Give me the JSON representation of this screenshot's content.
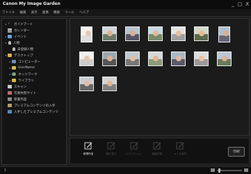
{
  "window": {
    "title": "Canon My Image Garden",
    "min": "_",
    "max": "□",
    "close": "X"
  },
  "menu": [
    "ファイル",
    "編集",
    "表示",
    "画像",
    "機能",
    "ツール",
    "ヘルプ"
  ],
  "sidebar": [
    {
      "label": "ガイドアート",
      "icon": "check-icon",
      "arrow": "▸"
    },
    {
      "label": "カレンダー",
      "icon": "calendar-icon",
      "arrow": ""
    },
    {
      "label": "イベント",
      "icon": "event-icon",
      "arrow": "▸"
    },
    {
      "label": "人物",
      "icon": "person-icon",
      "arrow": "▾"
    },
    {
      "label": "未登録人物",
      "icon": "person-icon",
      "arrow": "",
      "indent": 1
    },
    {
      "label": "デスクトップ",
      "icon": "folder-icon",
      "arrow": "▾"
    },
    {
      "label": "コンピューター",
      "icon": "pc-icon",
      "arrow": "▸",
      "indent": 1
    },
    {
      "label": "UserName",
      "icon": "folder-icon",
      "arrow": "▸",
      "indent": 1
    },
    {
      "label": "ネットワーク",
      "icon": "network-icon",
      "arrow": "▸",
      "indent": 1
    },
    {
      "label": "ライブラリ",
      "icon": "folder-icon",
      "arrow": "▸",
      "indent": 1
    },
    {
      "label": "スキャン",
      "icon": "scan-icon",
      "arrow": ""
    },
    {
      "label": "写真共有サイト",
      "icon": "photo-icon",
      "arrow": ""
    },
    {
      "label": "新着作品",
      "icon": "doc-icon",
      "arrow": ""
    },
    {
      "label": "プレミアムコンテンツの入手",
      "icon": "premium-icon",
      "arrow": ""
    },
    {
      "label": "入手したプレミアムコンテンツ",
      "icon": "download-icon",
      "arrow": ""
    }
  ],
  "toolbar": {
    "tools": [
      {
        "label": "新規作品",
        "state": "active"
      },
      {
        "label": "補正/加工",
        "state": "disabled"
      },
      {
        "label": "スライドショー",
        "state": "disabled"
      },
      {
        "label": "動画作成",
        "state": "disabled"
      },
      {
        "label": "メール添付",
        "state": "disabled"
      }
    ],
    "print": "印刷"
  },
  "status": {
    "left": "1"
  }
}
